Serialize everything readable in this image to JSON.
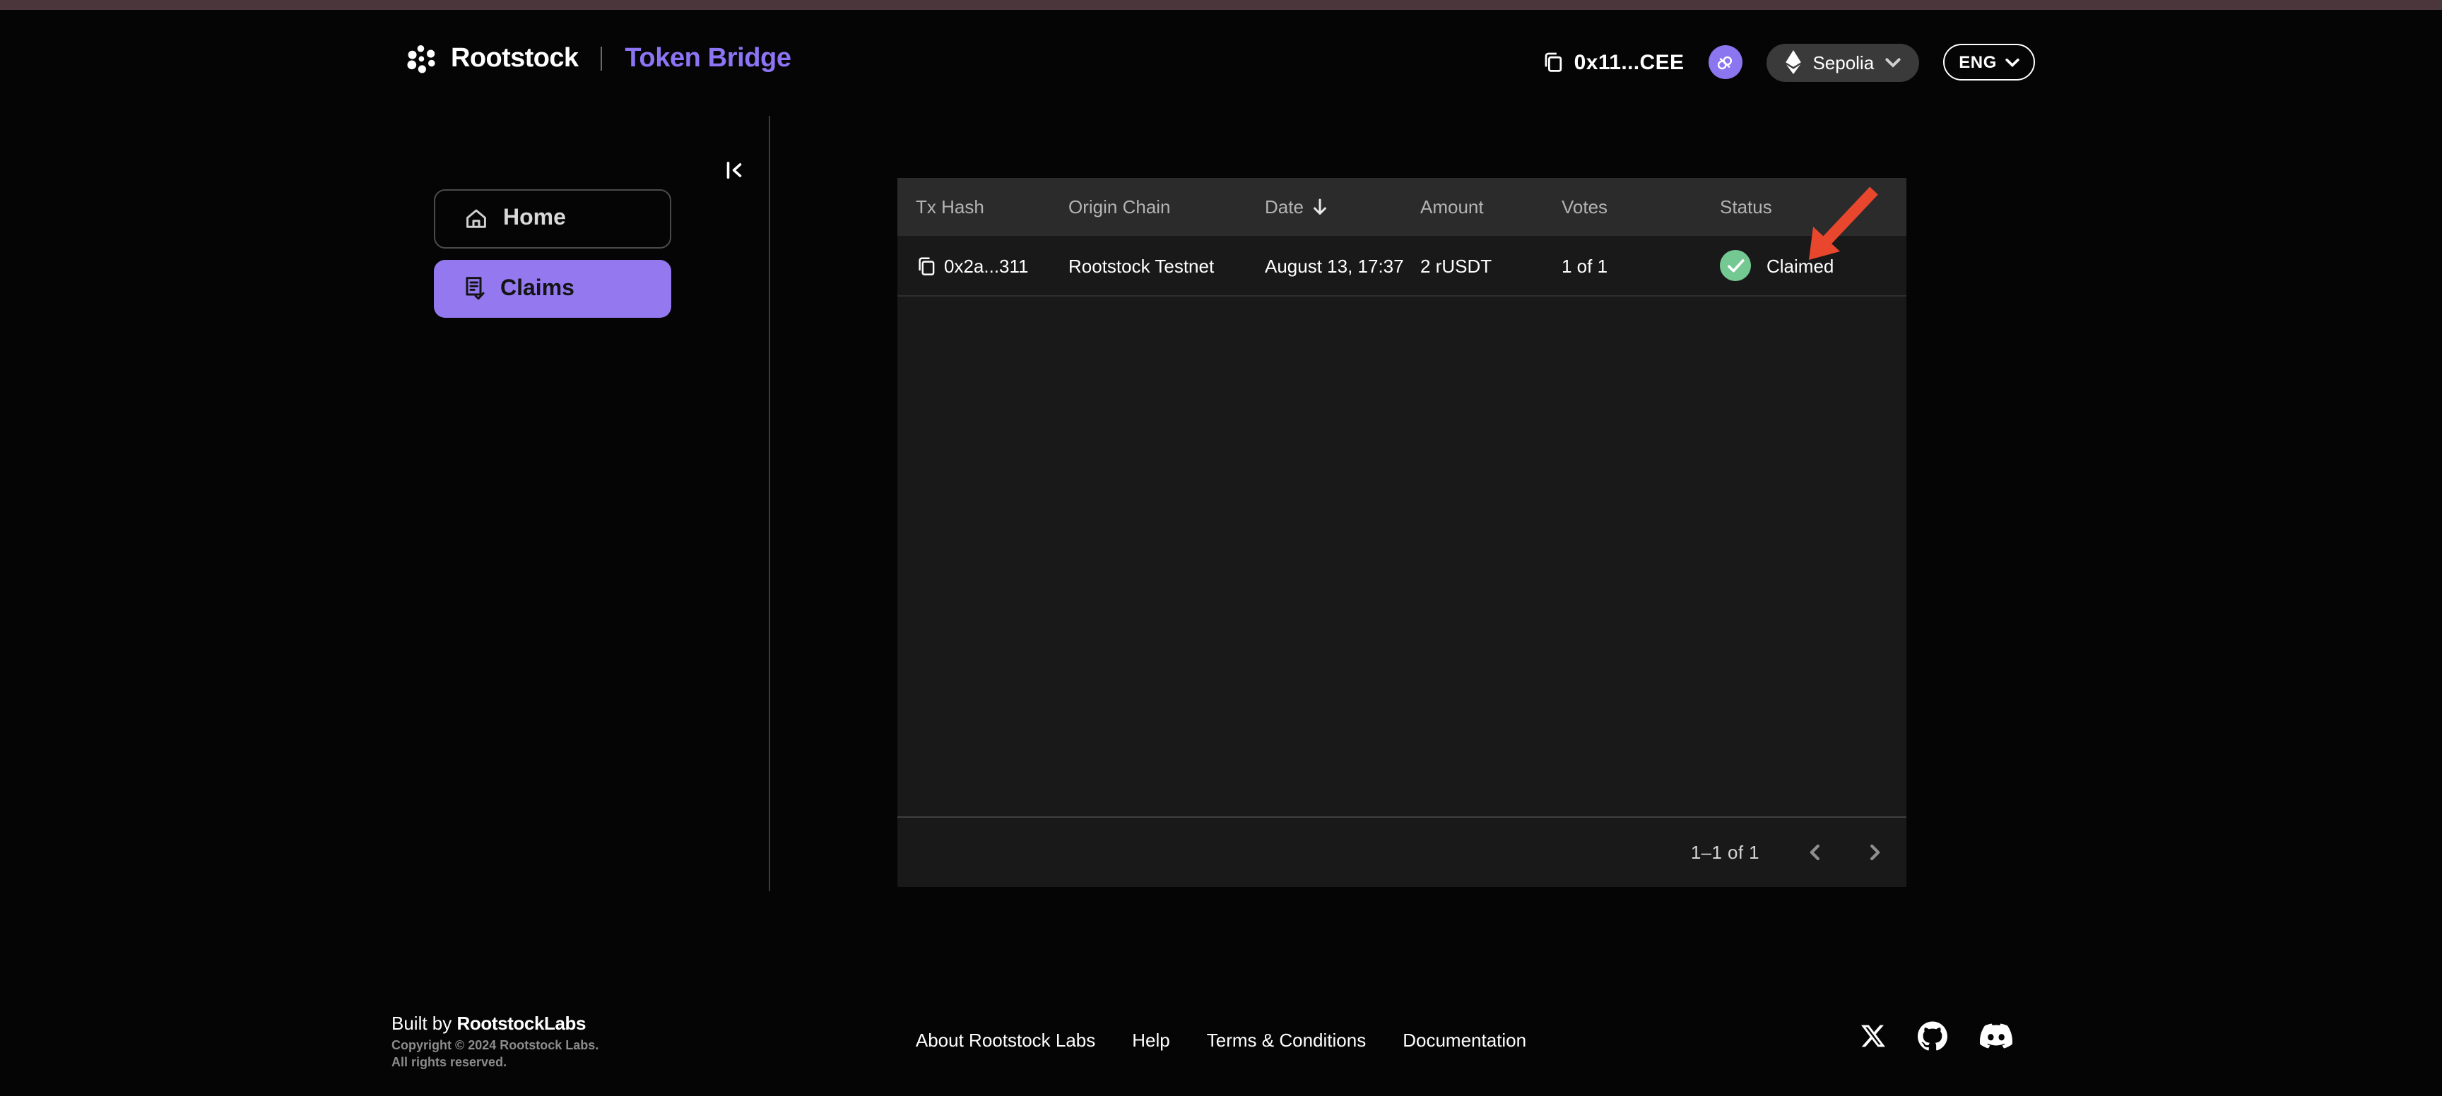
{
  "page": {
    "brand": "Rootstock",
    "app_name": "Token Bridge"
  },
  "header": {
    "wallet_address": "0x11...CEE",
    "network_label": "Sepolia",
    "language_label": "ENG"
  },
  "sidebar": {
    "items": [
      {
        "label": "Home",
        "icon": "home-icon"
      },
      {
        "label": "Claims",
        "icon": "claims-doc-check-icon",
        "active": true
      }
    ]
  },
  "table": {
    "columns": [
      "Tx Hash",
      "Origin Chain",
      "Date",
      "Amount",
      "Votes",
      "Status"
    ],
    "sort": {
      "column": "Date",
      "direction": "desc"
    },
    "rows": [
      {
        "tx_hash": "0x2a...311",
        "origin_chain": "Rootstock Testnet",
        "date": "August 13, 17:37",
        "amount": "2 rUSDT",
        "votes": "1 of 1",
        "status": "Claimed"
      }
    ],
    "pagination_label": "1–1 of 1"
  },
  "footer": {
    "built_by_prefix": "Built by ",
    "built_by_brand": "RootstockLabs",
    "copyright_line1": "Copyright © 2024 Rootstock Labs.",
    "copyright_line2": "All rights reserved.",
    "links": [
      {
        "label": "About Rootstock Labs"
      },
      {
        "label": "Help"
      },
      {
        "label": "Terms & Conditions"
      },
      {
        "label": "Documentation"
      }
    ],
    "social": [
      "x-twitter-icon",
      "github-icon",
      "discord-icon"
    ]
  },
  "colors": {
    "accent_purple": "#9478f0",
    "brand_purple_text": "#8d74f4",
    "status_green": "#74c892",
    "annotation_red": "#e8472e",
    "top_strip": "#4a363b",
    "table_bg": "#191919",
    "table_header_bg": "#2b2b2b"
  }
}
